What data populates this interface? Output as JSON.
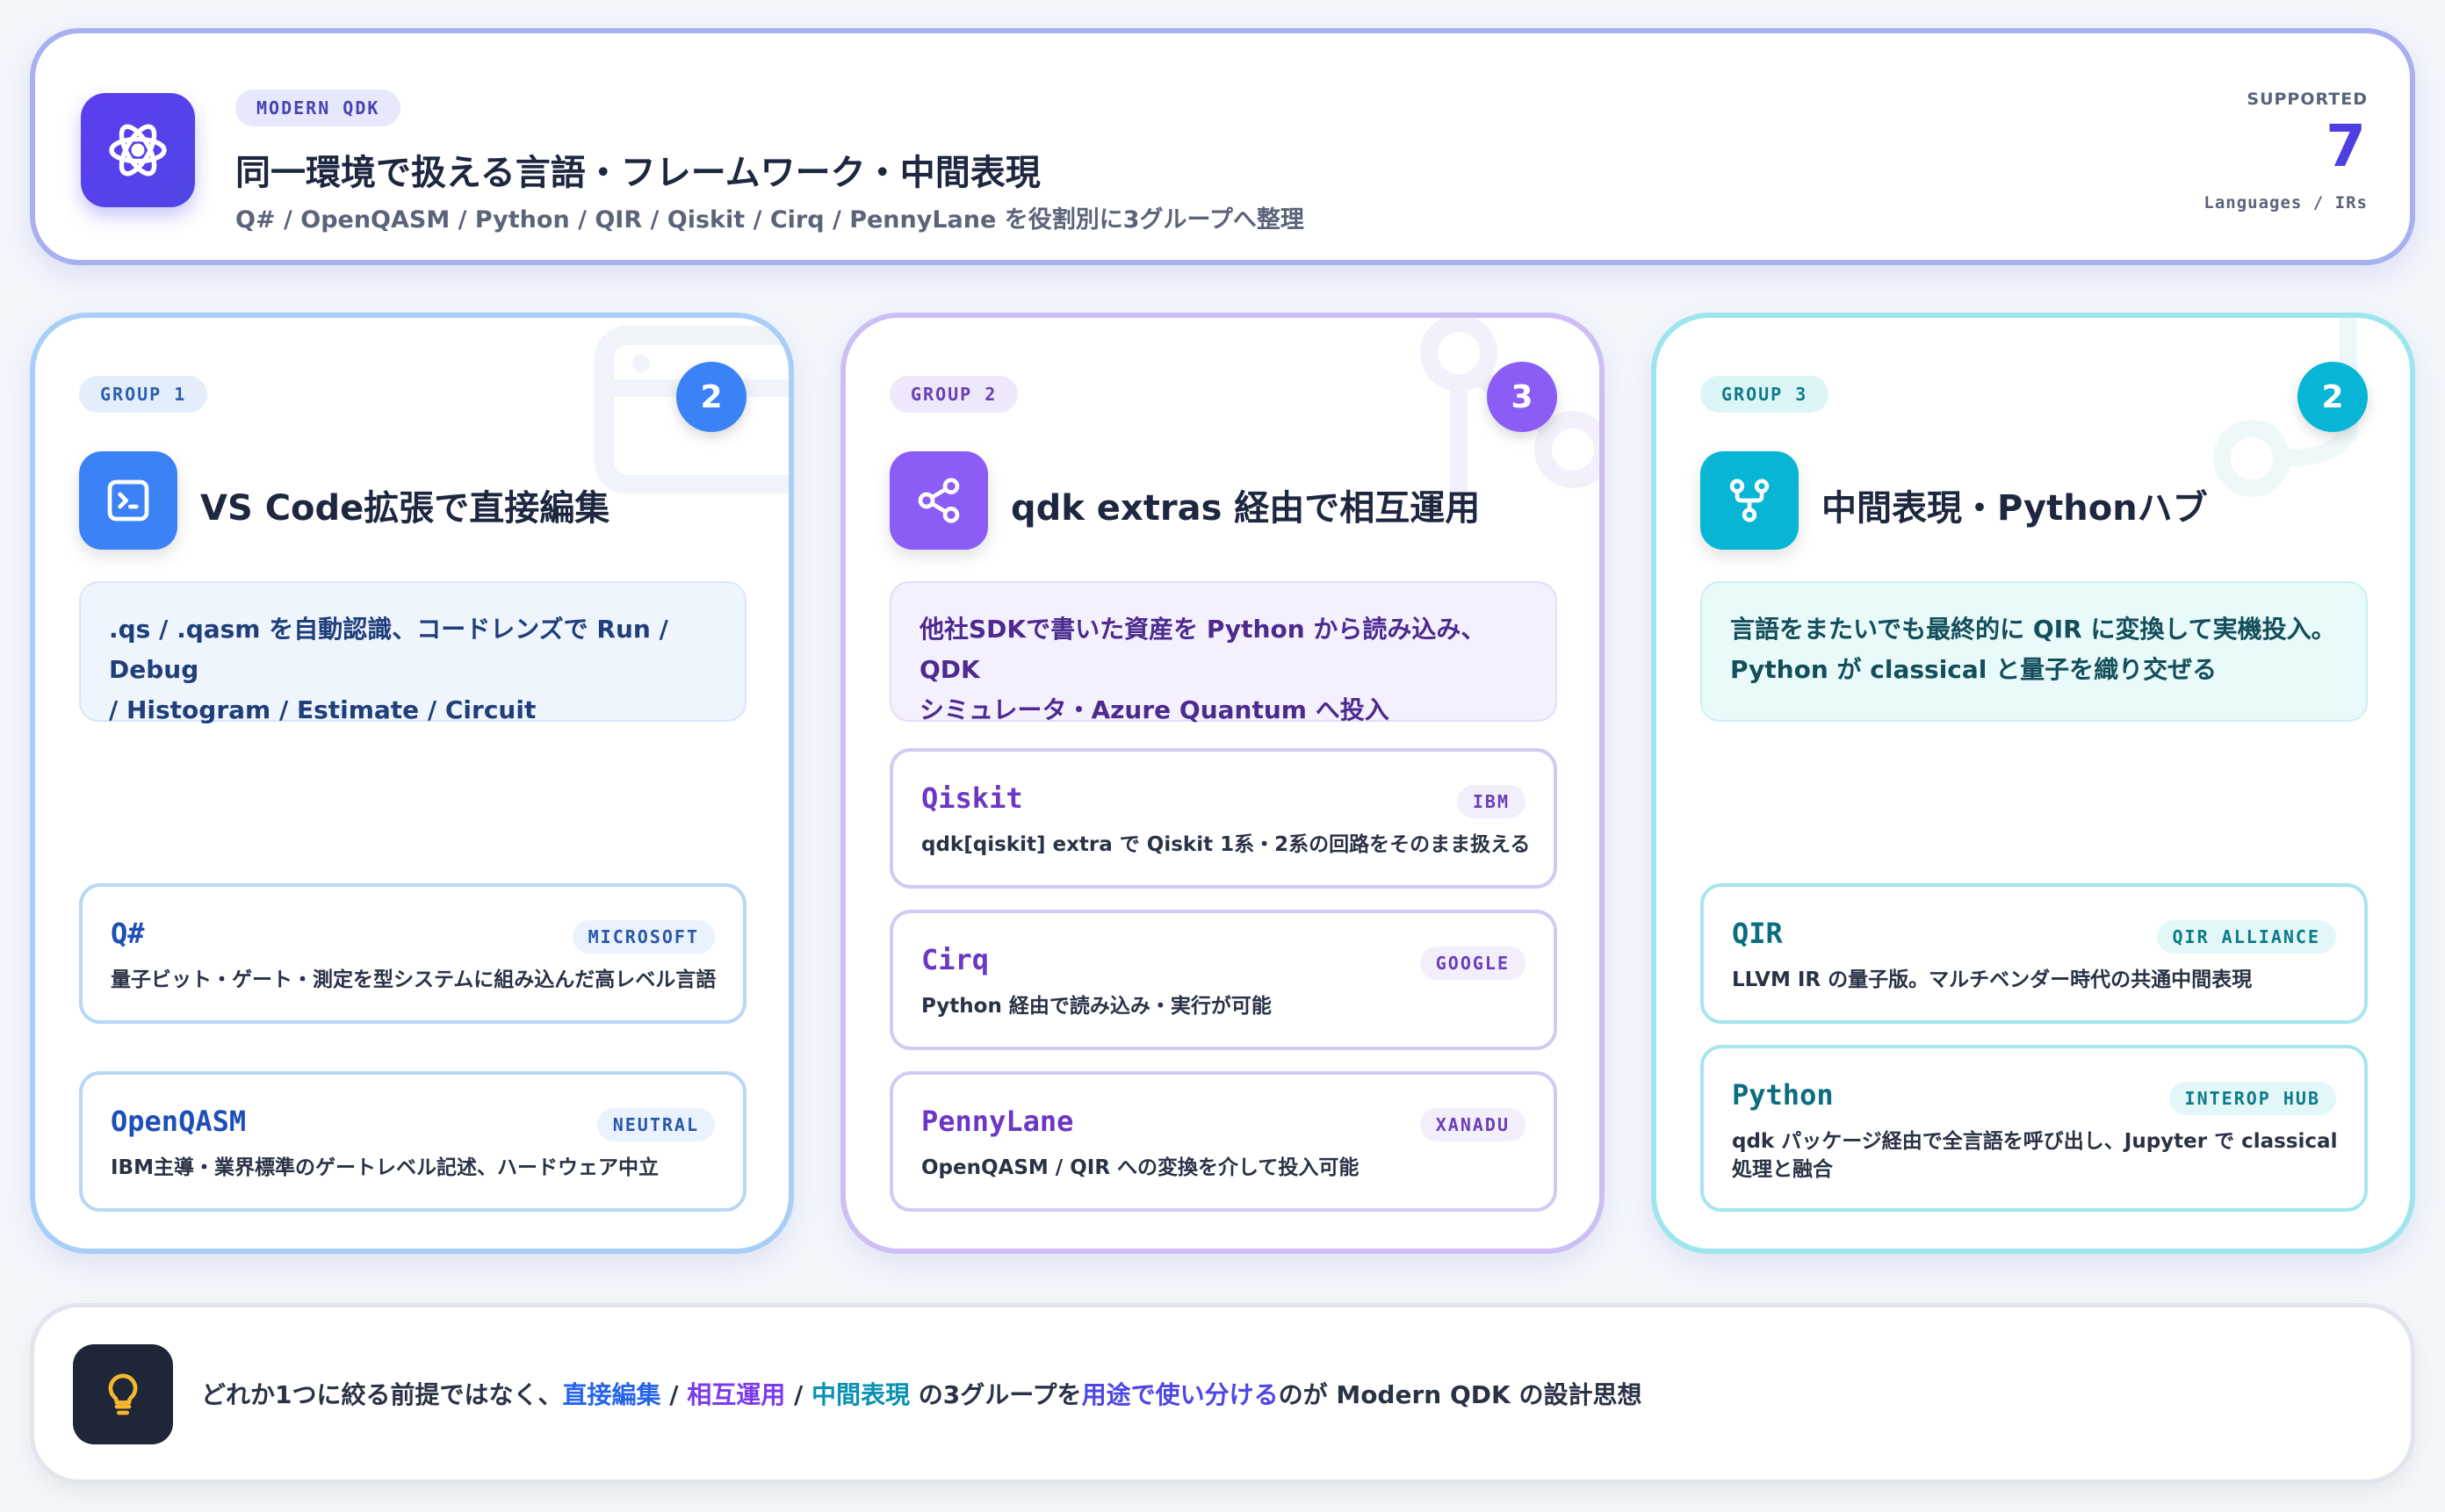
{
  "header": {
    "badge": "MODERN QDK",
    "title": "同一環境で扱える言語・フレームワーク・中間表現",
    "subtitle": "Q# / OpenQASM / Python / QIR / Qiskit / Cirq / PennyLane を役割別に3グループへ整理",
    "supported_label": "SUPPORTED",
    "supported_count": "7",
    "supported_units": "Languages / IRs",
    "icon": "atom-icon"
  },
  "groups": [
    {
      "badge": "GROUP 1",
      "count": "2",
      "icon": "terminal-icon",
      "title": "VS Code拡張で直接編集",
      "desc_line1": ".qs / .qasm を自動認識、コードレンズで Run / Debug",
      "desc_line2": "/ Histogram / Estimate / Circuit",
      "items": [
        {
          "name": "Q#",
          "tag": "MICROSOFT",
          "desc": "量子ビット・ゲート・測定を型システムに組み込んだ高レベル言語"
        },
        {
          "name": "OpenQASM",
          "tag": "NEUTRAL",
          "desc": "IBM主導・業界標準のゲートレベル記述、ハードウェア中立"
        }
      ]
    },
    {
      "badge": "GROUP 2",
      "count": "3",
      "icon": "share-icon",
      "title": "qdk extras 経由で相互運用",
      "desc_line1": "他社SDKで書いた資産を Python から読み込み、QDK",
      "desc_line2": "シミュレータ・Azure Quantum へ投入",
      "items": [
        {
          "name": "Qiskit",
          "tag": "IBM",
          "desc": "qdk[qiskit] extra で Qiskit 1系・2系の回路をそのまま扱える"
        },
        {
          "name": "Cirq",
          "tag": "GOOGLE",
          "desc": "Python 経由で読み込み・実行が可能"
        },
        {
          "name": "PennyLane",
          "tag": "XANADU",
          "desc": "OpenQASM / QIR への変換を介して投入可能"
        }
      ]
    },
    {
      "badge": "GROUP 3",
      "count": "2",
      "icon": "hub-icon",
      "title": "中間表現・Pythonハブ",
      "desc_line1": "言語をまたいでも最終的に QIR に変換して実機投入。",
      "desc_line2": "Python が classical と量子を織り交ぜる",
      "items": [
        {
          "name": "QIR",
          "tag": "QIR ALLIANCE",
          "desc": "LLVM IR の量子版。マルチベンダー時代の共通中間表現"
        },
        {
          "name": "Python",
          "tag": "INTEROP HUB",
          "desc": "qdk パッケージ経由で全言語を呼び出し、Jupyter で classical 処理と融合"
        }
      ]
    }
  ],
  "footer": {
    "icon": "lightbulb-icon",
    "t1": "どれか1つに絞る前提ではなく、",
    "h1": "直接編集",
    "s1": " / ",
    "h2": "相互運用",
    "s2": " / ",
    "h3": "中間表現",
    "t2": " の3グループを",
    "h4": "用途で使い分ける",
    "t3": "のが Modern QDK の設計思想"
  },
  "colors": {
    "group1": "#3b82f6",
    "group2": "#8b5cf6",
    "group3": "#06b6d4",
    "accent": "#4f46e5"
  }
}
